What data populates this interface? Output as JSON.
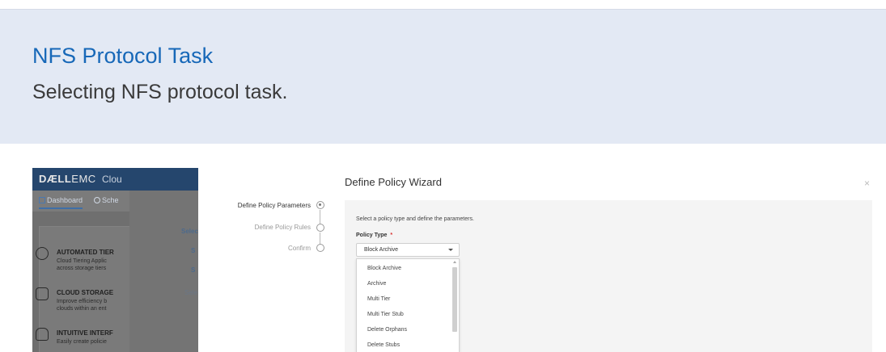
{
  "slide": {
    "title": "NFS Protocol Task",
    "subtitle": "Selecting NFS protocol task."
  },
  "dashboard": {
    "brand_bold": "DÆLL",
    "brand_rest": "EMC",
    "cloud_partial": "Clou",
    "tabs": [
      "Dashboard",
      "Sche"
    ],
    "features": [
      {
        "icon": "cloud-tiering-icon",
        "title": "AUTOMATED TIER",
        "desc_line1": "Cloud Tiering Applic",
        "desc_line2": "across storage tiers"
      },
      {
        "icon": "cloud-storage-icon",
        "title": "CLOUD STORAGE",
        "desc_line1": "Improve efficiency b",
        "desc_line2": "clouds within an ent"
      },
      {
        "icon": "hand-pointer-icon",
        "title": "INTUITIVE INTERF",
        "desc_line1": "Easily create policie",
        "desc_line2": ""
      }
    ],
    "side_fragments": [
      "Selec",
      "S",
      "S",
      "Sele"
    ]
  },
  "wizard": {
    "title": "Define Policy Wizard",
    "close_glyph": "×",
    "steps": [
      {
        "label": "Define Policy Parameters",
        "state": "active"
      },
      {
        "label": "Define Policy Rules",
        "state": "inactive"
      },
      {
        "label": "Confirm",
        "state": "inactive"
      }
    ],
    "instruction": "Select a policy type and define the parameters.",
    "policy_type": {
      "label": "Policy Type",
      "required_mark": "*",
      "selected": "Block Archive",
      "options": [
        "Block Archive",
        "Archive",
        "Multi Tier",
        "Multi Tier Stub",
        "Delete Orphans",
        "Delete Stubs"
      ]
    }
  },
  "colors": {
    "title_blue": "#1768b8",
    "slide_bg": "#e3e9f4",
    "dash_header": "#25466d",
    "required_red": "#d9302e"
  }
}
